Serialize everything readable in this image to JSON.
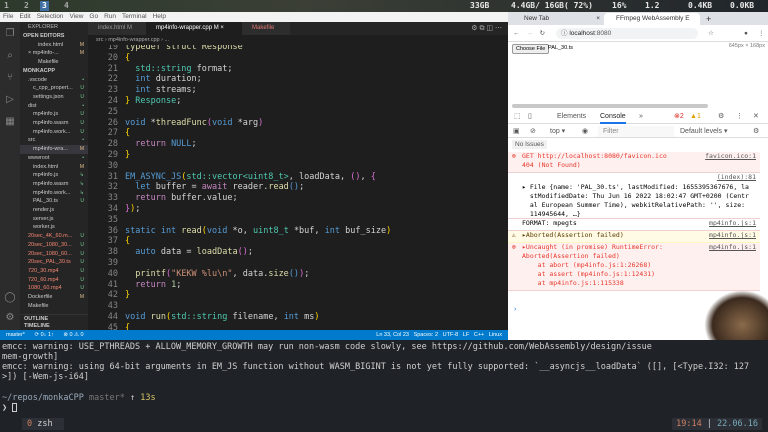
{
  "topbar": {
    "workspaces": [
      "1",
      "2",
      "3",
      "4"
    ],
    "disk": "33GB",
    "mem": "4.4GB/ 16GB( 72%)",
    "cpu": "16%",
    "load": "1.2",
    "down": "0.4KB",
    "up": "0.0KB"
  },
  "vscode": {
    "menu": [
      "File",
      "Edit",
      "Selection",
      "View",
      "Go",
      "Run",
      "Terminal",
      "Help"
    ],
    "explorer_title": "EXPLORER",
    "sidebar": [
      {
        "label": "OPEN EDITORS",
        "badge": "",
        "indent": 0,
        "head": true
      },
      {
        "label": "index.html",
        "badge": "M",
        "indent": 3
      },
      {
        "label": "× mp4info-...",
        "badge": "M",
        "indent": 1
      },
      {
        "label": "Makefile",
        "badge": "",
        "indent": 3
      },
      {
        "label": "MONKACPP",
        "badge": "",
        "indent": 0,
        "head": true
      },
      {
        "label": ".vscode",
        "badge": "•",
        "indent": 1
      },
      {
        "label": "c_cpp_propert...",
        "badge": "U",
        "indent": 2
      },
      {
        "label": "settings.json",
        "badge": "U",
        "indent": 2
      },
      {
        "label": "dist",
        "badge": "•",
        "indent": 1
      },
      {
        "label": "mp4info.js",
        "badge": "U",
        "indent": 2
      },
      {
        "label": "mp4info.wasm",
        "badge": "U",
        "indent": 2
      },
      {
        "label": "mp4info.work...",
        "badge": "U",
        "indent": 2
      },
      {
        "label": "src",
        "badge": "•",
        "indent": 1
      },
      {
        "label": "mp4info-wra...",
        "badge": "M",
        "indent": 2
      },
      {
        "label": "wwwroot",
        "badge": "•",
        "indent": 1
      },
      {
        "label": "index.html",
        "badge": "M",
        "indent": 2
      },
      {
        "label": "mp4info.js",
        "badge": "↳",
        "indent": 2
      },
      {
        "label": "mp4info.wasm",
        "badge": "↳",
        "indent": 2
      },
      {
        "label": "mp4info.work...",
        "badge": "↳",
        "indent": 2
      },
      {
        "label": "PAL_30.ts",
        "badge": "U",
        "indent": 2
      },
      {
        "label": "render.js",
        "badge": "",
        "indent": 2
      },
      {
        "label": "server.js",
        "badge": "",
        "indent": 2
      },
      {
        "label": "worker.js",
        "badge": "",
        "indent": 2
      },
      {
        "label": "20sec_4K_60.m...",
        "badge": "U",
        "indent": 1
      },
      {
        "label": "20sec_1080_30...",
        "badge": "U",
        "indent": 1
      },
      {
        "label": "20sec_1080_60...",
        "badge": "U",
        "indent": 1
      },
      {
        "label": "20sec_PAL_30.ts",
        "badge": "U",
        "indent": 1
      },
      {
        "label": "720_30.mp4",
        "badge": "U",
        "indent": 1
      },
      {
        "label": "720_60.mp4",
        "badge": "U",
        "indent": 1
      },
      {
        "label": "1080_60.mp4",
        "badge": "U",
        "indent": 1
      },
      {
        "label": "Dockerfile",
        "badge": "M",
        "indent": 1
      },
      {
        "label": "Makefile",
        "badge": "",
        "indent": 1
      }
    ],
    "outline": "OUTLINE",
    "timeline": "TIMELINE",
    "tabs": [
      {
        "label": "index.html M",
        "active": false
      },
      {
        "label": "mp4info-wrapper.cpp M ×",
        "active": true
      },
      {
        "label": "Makefile",
        "active": false
      }
    ],
    "breadcrumb": "src › mp4info-wrapper.cpp › ...",
    "code": [
      {
        "n": "19",
        "t": [
          [
            "typedef struct Response",
            "fn"
          ]
        ]
      },
      {
        "n": "20",
        "t": [
          [
            "{",
            "br"
          ]
        ]
      },
      {
        "n": "21",
        "t": [
          [
            "  std::string ",
            "ty"
          ],
          [
            "format;",
            ""
          ]
        ]
      },
      {
        "n": "22",
        "t": [
          [
            "  int ",
            "kw"
          ],
          [
            "duration;",
            ""
          ]
        ]
      },
      {
        "n": "23",
        "t": [
          [
            "  int ",
            "kw"
          ],
          [
            "streams;",
            ""
          ]
        ]
      },
      {
        "n": "24",
        "t": [
          [
            "} ",
            "br"
          ],
          [
            "Response",
            "ty"
          ],
          [
            ";",
            ""
          ]
        ]
      },
      {
        "n": "25",
        "t": []
      },
      {
        "n": "26",
        "t": [
          [
            "void ",
            "kw"
          ],
          [
            "*",
            ""
          ],
          [
            "threadFunc",
            "fn"
          ],
          [
            "(",
            "br2"
          ],
          [
            "void ",
            "kw"
          ],
          [
            "*arg",
            ""
          ],
          [
            ")",
            "br2"
          ]
        ]
      },
      {
        "n": "27",
        "t": [
          [
            "{",
            "br"
          ]
        ]
      },
      {
        "n": "28",
        "t": [
          [
            "  return ",
            "ctl"
          ],
          [
            "NULL",
            "kw"
          ],
          [
            ";",
            ""
          ]
        ]
      },
      {
        "n": "29",
        "t": [
          [
            "}",
            "br"
          ]
        ]
      },
      {
        "n": "30",
        "t": []
      },
      {
        "n": "31",
        "t": [
          [
            "EM_ASYNC_JS",
            "kw"
          ],
          [
            "(",
            "br"
          ],
          [
            "std::vector<uint8_t>",
            "ty"
          ],
          [
            ", loadData, ",
            ""
          ],
          [
            "()",
            "br2"
          ],
          [
            ", ",
            ""
          ],
          [
            "{",
            "br2"
          ]
        ]
      },
      {
        "n": "32",
        "t": [
          [
            "  let ",
            "kw"
          ],
          [
            "buffer = ",
            ""
          ],
          [
            "await ",
            "ctl"
          ],
          [
            "reader.",
            ""
          ],
          [
            "read",
            "fn"
          ],
          [
            "()",
            "kw"
          ],
          [
            ";",
            ""
          ]
        ]
      },
      {
        "n": "33",
        "t": [
          [
            "  return ",
            "ctl"
          ],
          [
            "buffer.value;",
            ""
          ]
        ]
      },
      {
        "n": "34",
        "t": [
          [
            "}",
            "br2"
          ],
          [
            ")",
            "br"
          ],
          [
            ";",
            ""
          ]
        ]
      },
      {
        "n": "35",
        "t": []
      },
      {
        "n": "36",
        "t": [
          [
            "static int ",
            "kw"
          ],
          [
            "read",
            "fn"
          ],
          [
            "(",
            "br"
          ],
          [
            "void ",
            "kw"
          ],
          [
            "*o, ",
            ""
          ],
          [
            "uint8_t ",
            "ty"
          ],
          [
            "*buf, ",
            ""
          ],
          [
            "int ",
            "kw"
          ],
          [
            "buf_size",
            ""
          ],
          [
            ")",
            "br"
          ]
        ]
      },
      {
        "n": "37",
        "t": [
          [
            "{",
            "br"
          ]
        ]
      },
      {
        "n": "38",
        "t": [
          [
            "  auto ",
            "kw"
          ],
          [
            "data = ",
            ""
          ],
          [
            "loadData",
            "fn"
          ],
          [
            "()",
            "br2"
          ],
          [
            ";",
            ""
          ]
        ]
      },
      {
        "n": "39",
        "t": []
      },
      {
        "n": "40",
        "t": [
          [
            "  printf",
            "fn"
          ],
          [
            "(",
            "br2"
          ],
          [
            "\"KEKW %lu\\n\"",
            "st"
          ],
          [
            ", data.",
            ""
          ],
          [
            "size",
            "fn"
          ],
          [
            "()",
            "kw"
          ],
          [
            ")",
            "br2"
          ],
          [
            ";",
            ""
          ]
        ]
      },
      {
        "n": "41",
        "t": [
          [
            "  return ",
            "ctl"
          ],
          [
            "1",
            "nm"
          ],
          [
            ";",
            ""
          ]
        ]
      },
      {
        "n": "42",
        "t": [
          [
            "}",
            "br"
          ]
        ]
      },
      {
        "n": "43",
        "t": []
      },
      {
        "n": "44",
        "t": [
          [
            "void ",
            "kw"
          ],
          [
            "run",
            "fn"
          ],
          [
            "(",
            "br"
          ],
          [
            "std::string ",
            "ty"
          ],
          [
            "filename, ",
            ""
          ],
          [
            "int ",
            "kw"
          ],
          [
            "ms",
            ""
          ],
          [
            ")",
            "br"
          ]
        ]
      },
      {
        "n": "45",
        "t": [
          [
            "{",
            "br"
          ]
        ]
      }
    ],
    "status_left": [
      "master*",
      "⟳ 0↓ 1↑",
      "⊗ 0 ⚠ 0"
    ],
    "status_right": [
      "Ln 33, Col 23",
      "Spaces: 2",
      "UTF-8",
      "LF",
      "C++",
      "Linux"
    ]
  },
  "browser": {
    "tabs": [
      "New Tab",
      "FFmpeg WebAssembly E"
    ],
    "url_host": "localhost",
    "url_port": ":8080",
    "choose_file": "Choose File",
    "file_name": "PAL_30.ts",
    "dims": "645px × 168px",
    "devtools": {
      "tabs": [
        "Elements",
        "Console"
      ],
      "errors": "2",
      "warnings": "1",
      "context": "top ▾",
      "filter_placeholder": "Filter",
      "levels": "Default levels ▾",
      "no_issues": "No Issues",
      "messages": [
        {
          "kind": "err",
          "text": "GET http://localhost:8080/favicon.ico\n404 (Not Found)",
          "src": "favicon.ico:1"
        },
        {
          "kind": "log",
          "text": "▸ File {name: 'PAL_30.ts', lastModified: 1655395367676, la\n  stModifiedDate: Thu Jun 16 2022 18:02:47 GMT+0200 (Centr\n  al European Summer Time), webkitRelativePath: '', size:\n  114945644, …}",
          "src": "(index):81"
        },
        {
          "kind": "log",
          "text": "FORMAT: mpegts",
          "src": "mp4info.js:1"
        },
        {
          "kind": "warn",
          "text": "▸Aborted(Assertion failed)",
          "src": "mp4info.js:1"
        },
        {
          "kind": "err",
          "text": "▸Uncaught (in promise) RuntimeError:\nAborted(Assertion failed)\n    at abort (mp4info.js:1:26268)\n    at assert (mp4info.js:1:12431)\n    at mp4info.js:1:115338",
          "src": "mp4info.js:1"
        }
      ],
      "prompt": "›"
    }
  },
  "terminal": {
    "lines": [
      "emcc: warning: USE_PTHREADS + ALLOW_MEMORY_GROWTH may run non-wasm code slowly, see https://github.com/WebAssembly/design/issue",
      "mem-growth]",
      "emcc: warning: using 64-bit arguments in EM_JS function without WASM_BIGINT is not yet fully supported: `__asyncjs__loadData` ([], [<Type.I32: 127",
      ">]) [-Wem-js-i64]"
    ],
    "cwd": "~/repos/monkaCPP",
    "branch": "master*",
    "arrow": "↑",
    "duration": "13s",
    "prompt": "❯",
    "tab_index": "0",
    "tab_name": "zsh",
    "time": "19:14",
    "date": "22.06.16"
  }
}
